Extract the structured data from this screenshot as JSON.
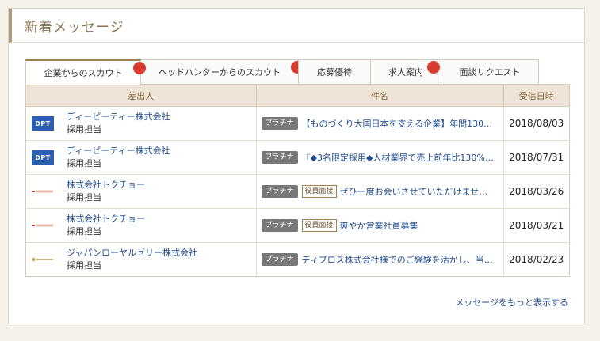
{
  "panel": {
    "title": "新着メッセージ",
    "more_link": "メッセージをもっと表示する"
  },
  "tabs": [
    {
      "label": "企業からのスカウト",
      "active": true,
      "notification": true
    },
    {
      "label": "ヘッドハンターからのスカウト",
      "active": false,
      "notification": true
    },
    {
      "label": "応募優待",
      "active": false,
      "notification": false
    },
    {
      "label": "求人案内",
      "active": false,
      "notification": true
    },
    {
      "label": "面談リクエスト",
      "active": false,
      "notification": false
    }
  ],
  "table": {
    "headers": {
      "sender": "差出人",
      "subject": "件名",
      "date": "受信日時"
    },
    "rows": [
      {
        "logo": "DPT",
        "company": "ディーピーティー株式会社",
        "person": "採用担当",
        "badge": "プラチナ",
        "badge2": "",
        "subject": "【ものづくり大国日本を支える企業】年間130…",
        "date": "2018/08/03"
      },
      {
        "logo": "DPT",
        "company": "ディーピーティー株式会社",
        "person": "採用担当",
        "badge": "プラチナ",
        "badge2": "",
        "subject": "『◆3名限定採用◆人材業界で売上前年比130%…",
        "date": "2018/07/31"
      },
      {
        "logo": "",
        "company": "株式会社トクチョー",
        "person": "採用担当",
        "badge": "プラチナ",
        "badge2": "役員面接",
        "subject": "ぜひ一度お会いさせていただけませ…",
        "date": "2018/03/26"
      },
      {
        "logo": "",
        "company": "株式会社トクチョー",
        "person": "採用担当",
        "badge": "プラチナ",
        "badge2": "役員面接",
        "subject": "爽やか営業社員募集",
        "date": "2018/03/21"
      },
      {
        "logo": "",
        "company": "ジャパンローヤルゼリー株式会社",
        "person": "採用担当",
        "badge": "プラチナ",
        "badge2": "",
        "subject": "ディプロス株式会社様でのご経験を活かし、当…",
        "date": "2018/02/23"
      }
    ]
  },
  "colors": {
    "accent": "#a0804f",
    "link": "#1e4c8c",
    "notification": "#d83c2f",
    "badge": "#787878",
    "header_bg": "#eee5d8"
  }
}
